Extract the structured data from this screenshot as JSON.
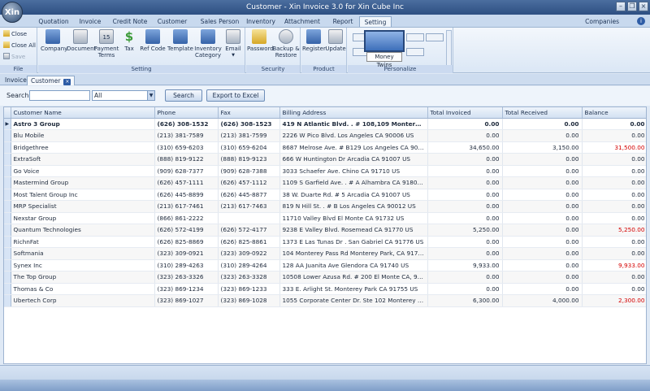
{
  "window": {
    "title": "Customer - Xin Invoice 3.0 for Xin Cube Inc",
    "app_logo": "Xin",
    "controls": [
      "minimize-icon",
      "restore-icon",
      "close-icon"
    ]
  },
  "ribbon_tabs": [
    "Quotation",
    "Invoice",
    "Credit Note",
    "Customer",
    "Sales Person",
    "Inventory",
    "Attachment",
    "Report",
    "Setting"
  ],
  "active_ribbon_tab": "Setting",
  "companies_label": "Companies",
  "ribbon": {
    "file": {
      "close": "Close",
      "close_all": "Close All",
      "save": "Save",
      "label": "File"
    },
    "setting": {
      "label": "Setting",
      "buttons": [
        "Company",
        "Document",
        "Payment\nTerms",
        "Tax",
        "Ref Code",
        "Template",
        "Inventory\nCategory",
        "Email"
      ],
      "payment_icon_text": "15"
    },
    "security": {
      "label": "Security",
      "buttons": [
        "Password",
        "Backup &\nRestore"
      ]
    },
    "product": {
      "label": "Product",
      "buttons": [
        "Register",
        "Update"
      ]
    },
    "personalize": {
      "label": "Personalize",
      "tooltip": "Money Twins"
    }
  },
  "doc_tabs": [
    "Invoice",
    "Customer"
  ],
  "search": {
    "label": "Search:",
    "value": "",
    "filter": "All",
    "search_button": "Search",
    "export_button": "Export to Excel"
  },
  "grid": {
    "columns": [
      "Customer Name",
      "Phone",
      "Fax",
      "Billing Address",
      "Total Invoiced",
      "Total Received",
      "Balance"
    ],
    "rows": [
      {
        "name": "Astro 3 Group",
        "phone": "(626) 308-1532",
        "fax": "(626) 308-1523",
        "address": "419 N Atlantic Blvd. . # 108,109 Monterey ...",
        "invoiced": "0.00",
        "received": "0.00",
        "balance": "0.00",
        "neg": false,
        "current": true
      },
      {
        "name": "Blu Mobile",
        "phone": "(213) 381-7589",
        "fax": "(213) 381-7599",
        "address": "2226 W Pico Blvd. Los Angeles CA 90006 US",
        "invoiced": "0.00",
        "received": "0.00",
        "balance": "0.00",
        "neg": false
      },
      {
        "name": "Bridgethree",
        "phone": "(310) 659-6203",
        "fax": "(310) 659-6204",
        "address": "8687 Melrose Ave. # B129 Los Angeles CA 9006...",
        "invoiced": "34,650.00",
        "received": "3,150.00",
        "balance": "31,500.00",
        "neg": true
      },
      {
        "name": "ExtraSoft",
        "phone": "(888) 819-9122",
        "fax": "(888) 819-9123",
        "address": "666 W Huntington Dr Arcadia CA 91007 US",
        "invoiced": "0.00",
        "received": "0.00",
        "balance": "0.00",
        "neg": false
      },
      {
        "name": "Go Voice",
        "phone": "(909) 628-7377",
        "fax": "(909) 628-7388",
        "address": "3033 Schaefer Ave. Chino CA 91710 US",
        "invoiced": "0.00",
        "received": "0.00",
        "balance": "0.00",
        "neg": false
      },
      {
        "name": "Mastermind Group",
        "phone": "(626) 457-1111",
        "fax": "(626) 457-1112",
        "address": "1109 S Garfield Ave. . # A Alhambra CA 91801 US",
        "invoiced": "0.00",
        "received": "0.00",
        "balance": "0.00",
        "neg": false
      },
      {
        "name": "Most Talent Group Inc",
        "phone": "(626) 445-8899",
        "fax": "(626) 445-8877",
        "address": "38 W. Duarte Rd. # 5 Arcadia CA 91007 US",
        "invoiced": "0.00",
        "received": "0.00",
        "balance": "0.00",
        "neg": false
      },
      {
        "name": "MRP Specialist",
        "phone": "(213) 617-7461",
        "fax": "(213) 617-7463",
        "address": "819 N Hill St. . # B Los Angeles CA 90012 US",
        "invoiced": "0.00",
        "received": "0.00",
        "balance": "0.00",
        "neg": false
      },
      {
        "name": "Nexstar Group",
        "phone": "(866) 861-2222",
        "fax": "",
        "address": "11710 Valley Blvd El Monte CA 91732 US",
        "invoiced": "0.00",
        "received": "0.00",
        "balance": "0.00",
        "neg": false
      },
      {
        "name": "Quantum Technologies",
        "phone": "(626) 572-4199",
        "fax": "(626) 572-4177",
        "address": "9238 E Valley Blvd. Rosemead CA 91770 US",
        "invoiced": "5,250.00",
        "received": "0.00",
        "balance": "5,250.00",
        "neg": true
      },
      {
        "name": "RichnFat",
        "phone": "(626) 825-8869",
        "fax": "(626) 825-8861",
        "address": "1373 E Las Tunas Dr . San Gabriel CA 91776 US",
        "invoiced": "0.00",
        "received": "0.00",
        "balance": "0.00",
        "neg": false
      },
      {
        "name": "Softmania",
        "phone": "(323) 309-0921",
        "fax": "(323) 309-0922",
        "address": "104 Monterey Pass Rd Monterey Park, CA 91754...",
        "invoiced": "0.00",
        "received": "0.00",
        "balance": "0.00",
        "neg": false
      },
      {
        "name": "Synex Inc",
        "phone": "(310) 289-4263",
        "fax": "(310) 289-4264",
        "address": "128 AA Juanita Ave Glendora CA 91740 US",
        "invoiced": "9,933.00",
        "received": "0.00",
        "balance": "9,933.00",
        "neg": true
      },
      {
        "name": "The Top Group",
        "phone": "(323) 263-3326",
        "fax": "(323) 263-3328",
        "address": "10508 Lower Azusa Rd. # 200 El Monte CA, 917...",
        "invoiced": "0.00",
        "received": "0.00",
        "balance": "0.00",
        "neg": false
      },
      {
        "name": "Thomas & Co",
        "phone": "(323) 869-1234",
        "fax": "(323) 869-1233",
        "address": "333 E. Arlight St. Monterey Park CA 91755 US",
        "invoiced": "0.00",
        "received": "0.00",
        "balance": "0.00",
        "neg": false
      },
      {
        "name": "Ubertech Corp",
        "phone": "(323) 869-1027",
        "fax": "(323) 869-1028",
        "address": "1055 Corporate Center Dr. Ste 102 Monterey Pa...",
        "invoiced": "6,300.00",
        "received": "4,000.00",
        "balance": "2,300.00",
        "neg": true
      }
    ]
  },
  "colors": {
    "negative_balance": "#d40000",
    "accent": "#2f5da6"
  }
}
